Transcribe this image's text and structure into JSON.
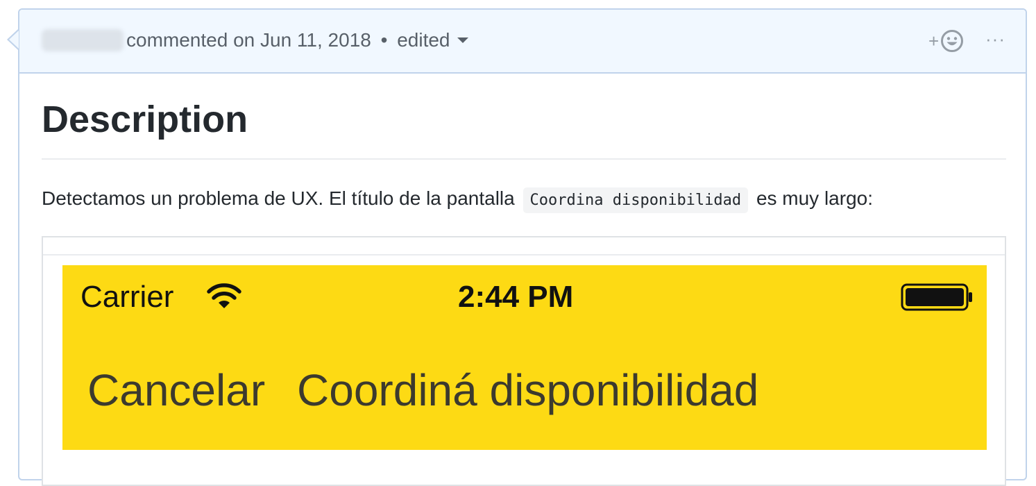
{
  "comment": {
    "action": "commented on",
    "date": "Jun 11, 2018",
    "separator": "•",
    "edited": "edited",
    "reaction_plus": "+",
    "more": "···"
  },
  "body": {
    "heading": "Description",
    "para_before": "Detectamos un problema de UX. El título de la pantalla",
    "code": "Coordina disponibilidad",
    "para_after": "es muy largo:"
  },
  "screenshot": {
    "carrier": "Carrier",
    "time": "2:44 PM",
    "cancel": "Cancelar",
    "title": "Coordiná disponibilidad",
    "background": "#fdda14"
  },
  "icons": {
    "caret": "chevron-down-icon",
    "smiley": "smiley-icon",
    "wifi": "wifi-icon",
    "battery": "battery-icon"
  },
  "colors": {
    "header_bg": "#f1f8ff",
    "header_border": "#c0d3eb",
    "muted": "#586069"
  }
}
